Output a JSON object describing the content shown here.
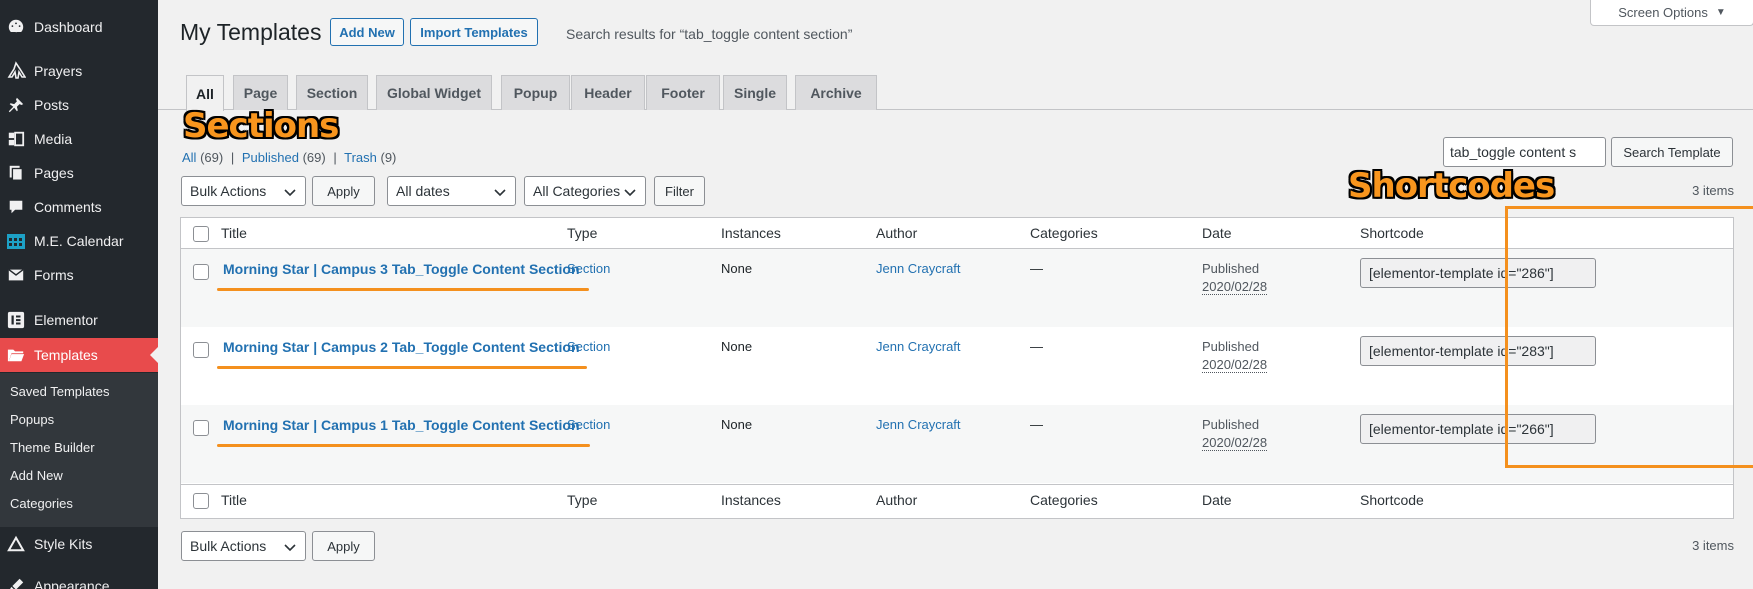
{
  "sidebar": {
    "items": [
      {
        "label": "Dashboard",
        "icon": "dashboard-icon"
      },
      {
        "label": "Prayers",
        "icon": "prayers-icon"
      },
      {
        "label": "Posts",
        "icon": "pin-icon"
      },
      {
        "label": "Media",
        "icon": "media-icon"
      },
      {
        "label": "Pages",
        "icon": "pages-icon"
      },
      {
        "label": "Comments",
        "icon": "comments-icon"
      },
      {
        "label": "M.E. Calendar",
        "icon": "calendar-icon"
      },
      {
        "label": "Forms",
        "icon": "forms-icon"
      },
      {
        "label": "Elementor",
        "icon": "elementor-icon"
      },
      {
        "label": "Templates",
        "icon": "folder-icon"
      },
      {
        "label": "Style Kits",
        "icon": "stylekits-icon"
      },
      {
        "label": "Appearance",
        "icon": "appearance-icon"
      }
    ],
    "submenu": [
      "Saved Templates",
      "Popups",
      "Theme Builder",
      "Add New",
      "Categories"
    ],
    "colors": {
      "bg": "#23282d",
      "current": "#e84b4c",
      "submenu_bg": "#32373c",
      "calendar_icon": "#1da1c6"
    }
  },
  "header": {
    "title": "My Templates",
    "add_new": "Add New",
    "import": "Import Templates",
    "search_results": "Search results for “tab_toggle content section”",
    "screen_options": "Screen Options"
  },
  "tabs": [
    "All",
    "Page",
    "Section",
    "Global Widget",
    "Popup",
    "Header",
    "Footer",
    "Single",
    "Archive"
  ],
  "filters": {
    "all_label": "All",
    "all_count": "(69)",
    "published_label": "Published",
    "published_count": "(69)",
    "trash_label": "Trash",
    "trash_count": "(9)",
    "sep": "|"
  },
  "search": {
    "value": "tab_toggle content s",
    "button": "Search Template"
  },
  "bulk": {
    "bulk_actions": "Bulk Actions",
    "apply": "Apply",
    "all_dates": "All dates",
    "all_categories": "All Categories",
    "filter": "Filter",
    "items_count": "3 items"
  },
  "table": {
    "headers": {
      "title": "Title",
      "type": "Type",
      "instances": "Instances",
      "author": "Author",
      "categories": "Categories",
      "date": "Date",
      "shortcode": "Shortcode"
    },
    "rows": [
      {
        "title": "Morning Star | Campus 3 Tab_Toggle Content Section",
        "type": "Section",
        "instances": "None",
        "author": "Jenn Craycraft",
        "categories": "—",
        "status": "Published",
        "date": "2020/02/28",
        "shortcode": "[elementor-template id=\"286\"]"
      },
      {
        "title": "Morning Star | Campus 2 Tab_Toggle Content Section",
        "type": "Section",
        "instances": "None",
        "author": "Jenn Craycraft",
        "categories": "—",
        "status": "Published",
        "date": "2020/02/28",
        "shortcode": "[elementor-template id=\"283\"]"
      },
      {
        "title": "Morning Star | Campus 1 Tab_Toggle Content Section",
        "type": "Section",
        "instances": "None",
        "author": "Jenn Craycraft",
        "categories": "—",
        "status": "Published",
        "date": "2020/02/28",
        "shortcode": "[elementor-template id=\"266\"]"
      }
    ]
  },
  "annotations": {
    "sections": "Sections",
    "shortcodes": "Shortcodes",
    "color": "#f4901e"
  }
}
